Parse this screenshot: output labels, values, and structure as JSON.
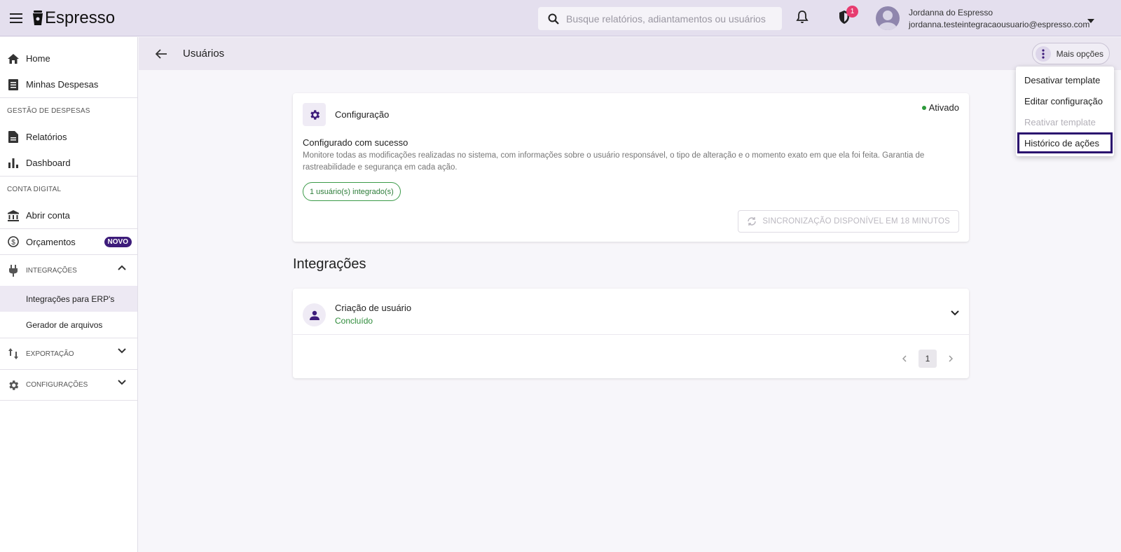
{
  "app": {
    "name": "Espresso"
  },
  "search": {
    "placeholder": "Busque relatórios, adiantamentos ou usuários"
  },
  "notifications": {
    "shield_badge_count": "1"
  },
  "user": {
    "name": "Jordanna do Espresso",
    "email": "jordanna.testeintegracaousuario@espresso.com"
  },
  "sidebar": {
    "home": "Home",
    "minhas_despesas": "Minhas Despesas",
    "section_gestao": "GESTÃO DE DESPESAS",
    "relatorios": "Relatórios",
    "dashboard": "Dashboard",
    "section_conta": "CONTA DIGITAL",
    "abrir_conta": "Abrir conta",
    "orcamentos": "Orçamentos",
    "novo_badge": "NOVO",
    "integracoes": "INTEGRAÇÕES",
    "integracoes_erp": "Integrações para ERP's",
    "gerador_arquivos": "Gerador de arquivos",
    "exportacao": "EXPORTAÇÃO",
    "configuracoes": "CONFIGURAÇÕES"
  },
  "page": {
    "title": "Usuários",
    "more_options": "Mais opções"
  },
  "menu": {
    "items": [
      {
        "label": "Desativar template",
        "state": "enabled"
      },
      {
        "label": "Editar configuração",
        "state": "enabled"
      },
      {
        "label": "Reativar template",
        "state": "disabled"
      },
      {
        "label": "Histórico de ações",
        "state": "focused"
      }
    ]
  },
  "config_card": {
    "title": "Configuração",
    "status": "Ativado",
    "heading": "Configurado com sucesso",
    "description": "Monitore todas as modificações realizadas no sistema, com informações sobre o usuário responsável, o tipo de alteração e o momento exato em que ela foi feita. Garantia de rastreabilidade e segurança em cada ação.",
    "chip": "1 usuário(s) integrado(s)",
    "sync_button": "SINCRONIZAÇÃO DISPONÍVEL EM 18 MINUTOS"
  },
  "integrations": {
    "section_title": "Integrações",
    "items": [
      {
        "title": "Criação de usuário",
        "status": "Concluído"
      }
    ],
    "pagination": {
      "current_page": "1"
    }
  },
  "colors": {
    "accent": "#3d1c7a",
    "topbar": "#e4dfee",
    "success": "#2c9a3a",
    "badge": "#e73c70"
  }
}
